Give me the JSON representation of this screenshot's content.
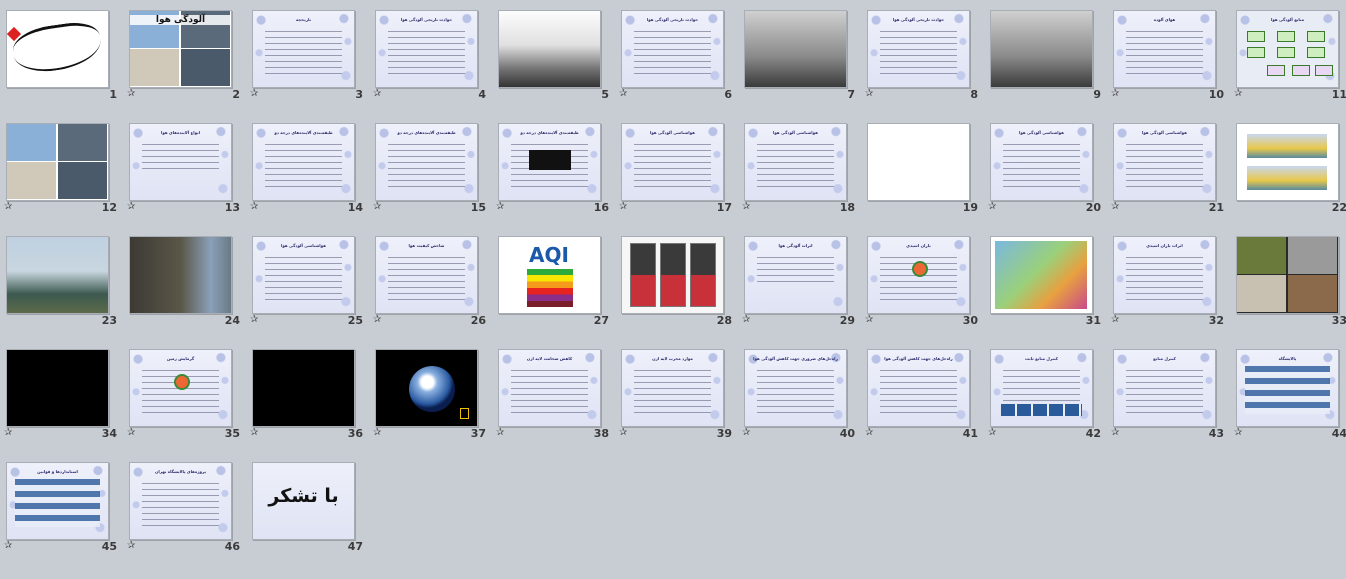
{
  "slides": [
    {
      "number": "1",
      "title": "",
      "kind": "calligraphy",
      "has_transition": false
    },
    {
      "number": "2",
      "title": "آلودگی هوا",
      "kind": "title-collage",
      "has_transition": true
    },
    {
      "number": "3",
      "title": "تاریخچه",
      "kind": "text",
      "has_transition": true
    },
    {
      "number": "4",
      "title": "حوادث تاریخی آلودگی هوا",
      "kind": "text",
      "has_transition": true
    },
    {
      "number": "5",
      "title": "",
      "kind": "mountain-fog",
      "has_transition": false
    },
    {
      "number": "6",
      "title": "حوادث تاریخی آلودگی هوا",
      "kind": "text",
      "has_transition": true
    },
    {
      "number": "7",
      "title": "",
      "kind": "street-fog",
      "has_transition": false
    },
    {
      "number": "8",
      "title": "حوادث تاریخی آلودگی هوا",
      "kind": "text",
      "has_transition": true
    },
    {
      "number": "9",
      "title": "",
      "kind": "city-smog",
      "has_transition": false
    },
    {
      "number": "10",
      "title": "هوای آلوده",
      "kind": "text",
      "has_transition": true
    },
    {
      "number": "11",
      "title": "منابع آلودگی هوا",
      "kind": "diagram",
      "has_transition": true
    },
    {
      "number": "12",
      "title": "",
      "kind": "photo-collage",
      "has_transition": true
    },
    {
      "number": "13",
      "title": "انواع آلاینده‌های هوا",
      "kind": "text-short",
      "has_transition": true
    },
    {
      "number": "14",
      "title": "طبقه‌بندی آلاینده‌های درجه دو",
      "kind": "text",
      "has_transition": true
    },
    {
      "number": "15",
      "title": "طبقه‌بندی آلاینده‌های درجه دو",
      "kind": "text",
      "has_transition": true
    },
    {
      "number": "16",
      "title": "طبقه‌بندی آلاینده‌های درجه دو",
      "kind": "text-image",
      "has_transition": true
    },
    {
      "number": "17",
      "title": "هواشناسی آلودگی هوا",
      "kind": "text",
      "has_transition": true
    },
    {
      "number": "18",
      "title": "هواشناسی آلودگی هوا",
      "kind": "text",
      "has_transition": true
    },
    {
      "number": "19",
      "title": "",
      "kind": "white-diagram",
      "has_transition": false
    },
    {
      "number": "20",
      "title": "هواشناسی آلودگی هوا",
      "kind": "text",
      "has_transition": true
    },
    {
      "number": "21",
      "title": "هواشناسی آلودگی هوا",
      "kind": "text",
      "has_transition": true
    },
    {
      "number": "22",
      "title": "",
      "kind": "inversion",
      "has_transition": false
    },
    {
      "number": "23",
      "title": "",
      "kind": "bridge",
      "has_transition": false
    },
    {
      "number": "24",
      "title": "",
      "kind": "building",
      "has_transition": false
    },
    {
      "number": "25",
      "title": "هواشناسی آلودگی هوا",
      "kind": "text",
      "has_transition": true
    },
    {
      "number": "26",
      "title": "شاخص کیفیت هوا",
      "kind": "text",
      "has_transition": true
    },
    {
      "number": "27",
      "title": "",
      "kind": "aqi",
      "has_transition": false
    },
    {
      "number": "28",
      "title": "",
      "kind": "thermometer",
      "has_transition": false
    },
    {
      "number": "29",
      "title": "اثرات آلودگی هوا",
      "kind": "text-short",
      "has_transition": true
    },
    {
      "number": "30",
      "title": "باران اسیدی",
      "kind": "text-logo",
      "has_transition": true
    },
    {
      "number": "31",
      "title": "",
      "kind": "acid-rain",
      "has_transition": false
    },
    {
      "number": "32",
      "title": "اثرات باران اسیدی",
      "kind": "text",
      "has_transition": true
    },
    {
      "number": "33",
      "title": "",
      "kind": "photos-four",
      "has_transition": false
    },
    {
      "number": "34",
      "title": "",
      "kind": "black",
      "has_transition": true
    },
    {
      "number": "35",
      "title": "گرمایش زمین",
      "kind": "text-logo",
      "has_transition": true
    },
    {
      "number": "36",
      "title": "",
      "kind": "black",
      "has_transition": true
    },
    {
      "number": "37",
      "title": "",
      "kind": "earth",
      "has_transition": true
    },
    {
      "number": "38",
      "title": "کاهش ضخامت لایه ازن",
      "kind": "text",
      "has_transition": true
    },
    {
      "number": "39",
      "title": "موارد مخرب لایه ازن",
      "kind": "text",
      "has_transition": true
    },
    {
      "number": "40",
      "title": "راه‌حل‌های ضروری جهت کاهش آلودگی هوا",
      "kind": "text",
      "has_transition": true
    },
    {
      "number": "41",
      "title": "راه‌حل‌های جهت کاهش آلودگی هوا",
      "kind": "text",
      "has_transition": true
    },
    {
      "number": "42",
      "title": "کنترل منابع ثابت",
      "kind": "text-table",
      "has_transition": true
    },
    {
      "number": "43",
      "title": "کنترل منابع",
      "kind": "text",
      "has_transition": true
    },
    {
      "number": "44",
      "title": "پالایشگاه",
      "kind": "table",
      "has_transition": true
    },
    {
      "number": "45",
      "title": "استانداردها و قوانین",
      "kind": "table-blue",
      "has_transition": true
    },
    {
      "number": "46",
      "title": "پروژه‌های پالایشگاه تهران",
      "kind": "text",
      "has_transition": true
    },
    {
      "number": "47",
      "title": "",
      "kind": "thanks",
      "big_text": "با تشکر",
      "has_transition": false
    }
  ],
  "icons": {
    "transition": "star-icon"
  },
  "colors": {
    "background": "#c8ccd3",
    "number_text": "#3a3a3a"
  }
}
